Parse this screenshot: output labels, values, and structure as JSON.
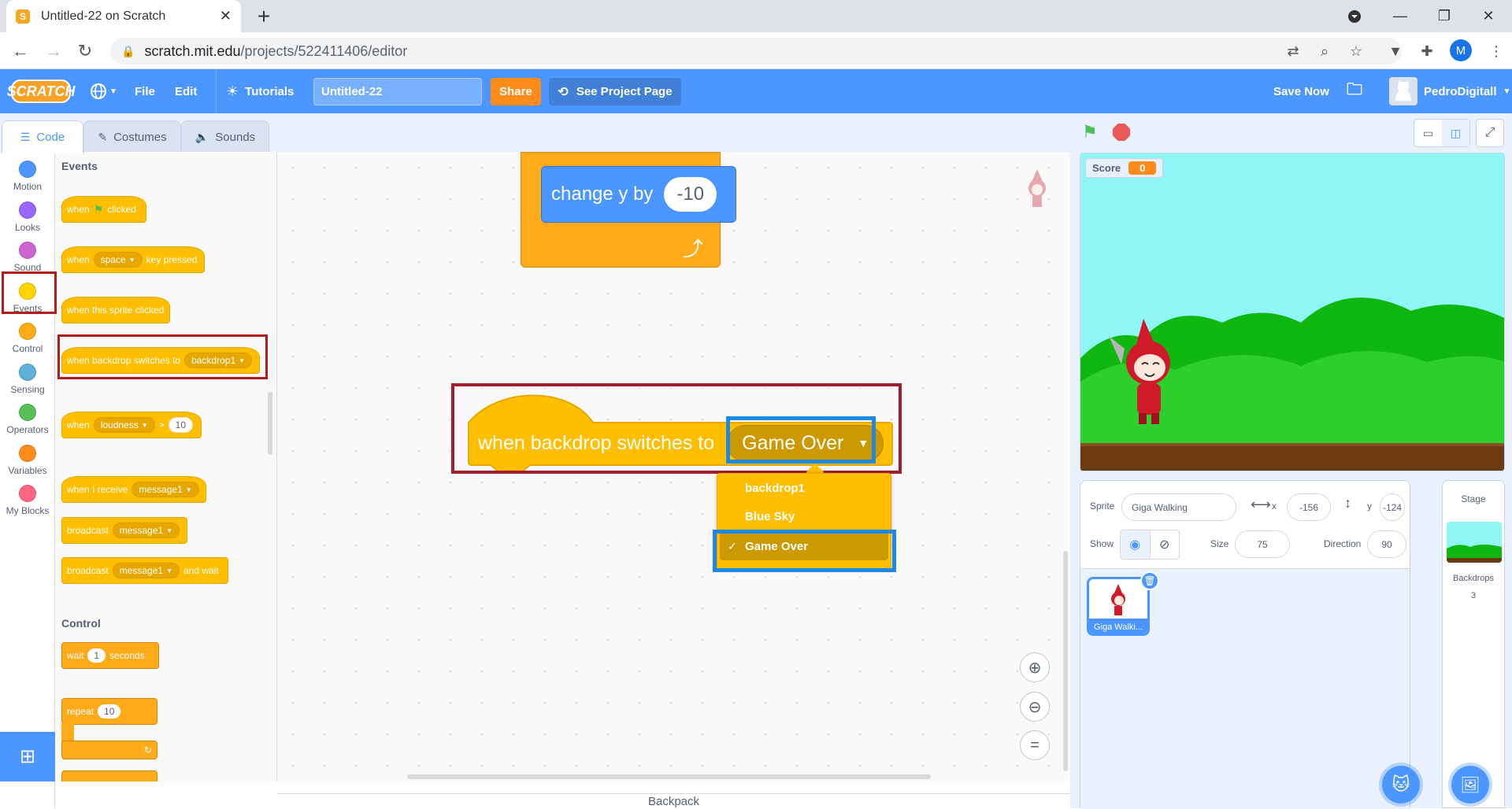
{
  "browser": {
    "tab_title": "Untitled-22 on Scratch",
    "url_host": "scratch.mit.edu",
    "url_path": "/projects/522411406/editor",
    "profile_initial": "M"
  },
  "menubar": {
    "logo": "SCRATCH",
    "file": "File",
    "edit": "Edit",
    "tutorials": "Tutorials",
    "project_name": "Untitled-22",
    "share": "Share",
    "see_project": "See Project Page",
    "save_now": "Save Now",
    "username": "PedroDigitall"
  },
  "tabs": {
    "code": "Code",
    "costumes": "Costumes",
    "sounds": "Sounds"
  },
  "categories": [
    {
      "label": "Motion",
      "color": "#4c97ff"
    },
    {
      "label": "Looks",
      "color": "#9966ff"
    },
    {
      "label": "Sound",
      "color": "#cf63cf"
    },
    {
      "label": "Events",
      "color": "#ffd500"
    },
    {
      "label": "Control",
      "color": "#ffab19"
    },
    {
      "label": "Sensing",
      "color": "#5cb1d6"
    },
    {
      "label": "Operators",
      "color": "#59c059"
    },
    {
      "label": "Variables",
      "color": "#ff8c1a"
    },
    {
      "label": "My Blocks",
      "color": "#ff6680"
    }
  ],
  "palette": {
    "events_title": "Events",
    "flag_when": "when",
    "flag_clicked": "clicked",
    "key_when": "when",
    "key_value": "space",
    "key_pressed": "key pressed",
    "sprite_clicked": "when this sprite clicked",
    "backdrop_text": "when backdrop switches to",
    "backdrop_value": "backdrop1",
    "loud_when": "when",
    "loud_value": "loudness",
    "loud_op": ">",
    "loud_num": "10",
    "receive_text": "when I receive",
    "receive_value": "message1",
    "broadcast_text": "broadcast",
    "broadcast_value": "message1",
    "bwait_text": "broadcast",
    "bwait_value": "message1",
    "bwait_suffix": "and wait",
    "control_title": "Control",
    "wait_text": "wait",
    "wait_num": "1",
    "wait_suffix": "seconds",
    "repeat_text": "repeat",
    "repeat_num": "10"
  },
  "script": {
    "change_y_text": "change y by",
    "change_y_value": "-10",
    "hat_text": "when backdrop switches to",
    "hat_value": "Game Over"
  },
  "dropdown": {
    "options": [
      "backdrop1",
      "Blue Sky",
      "Game Over"
    ],
    "selected": "Game Over",
    "check": "✓"
  },
  "backpack": "Backpack",
  "stage": {
    "monitor_label": "Score",
    "monitor_value": "0"
  },
  "sprite_info": {
    "sprite_label": "Sprite",
    "sprite_name": "Giga Walking",
    "x_label": "x",
    "x_value": "-156",
    "y_label": "y",
    "y_value": "-124",
    "show_label": "Show",
    "size_label": "Size",
    "size_value": "75",
    "direction_label": "Direction",
    "direction_value": "90",
    "thumb_name": "Giga Walki..."
  },
  "stage_pane": {
    "title": "Stage",
    "backdrops_label": "Backdrops",
    "backdrops_count": "3"
  },
  "colors": {
    "scratch_blue": "#4c97ff",
    "events_yellow": "#ffbf00",
    "control_orange": "#ffab19",
    "highlight_red": "#b01c1c",
    "highlight_blue": "#1e88e5"
  }
}
